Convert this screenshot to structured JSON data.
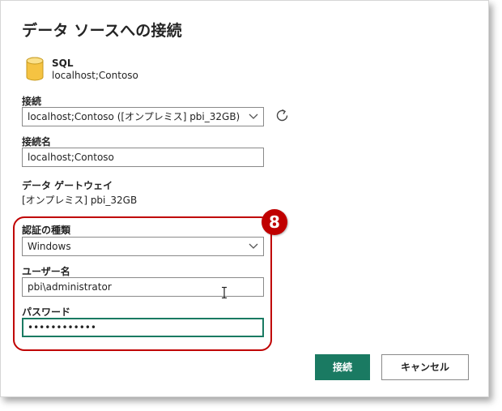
{
  "dialog": {
    "title": "データ ソースへの接続"
  },
  "source": {
    "type": "SQL",
    "path": "localhost;Contoso",
    "icon": "database-icon"
  },
  "connection": {
    "label": "接続",
    "selected": "localhost;Contoso ([オンプレミス] pbi_32GB)"
  },
  "connection_name": {
    "label": "接続名",
    "value": "localhost;Contoso"
  },
  "gateway": {
    "label": "データ ゲートウェイ",
    "value": "[オンプレミス] pbi_32GB"
  },
  "auth": {
    "label": "認証の種類",
    "selected": "Windows"
  },
  "username": {
    "label": "ユーザー名",
    "value": "pbi\\administrator"
  },
  "password": {
    "label": "パスワード",
    "value": "••••••••••••"
  },
  "step_badge": "8",
  "buttons": {
    "connect": "接続",
    "cancel": "キャンセル"
  },
  "colors": {
    "accent": "#1a7a62",
    "highlight": "#c00000",
    "db_icon": "#f5c342"
  }
}
